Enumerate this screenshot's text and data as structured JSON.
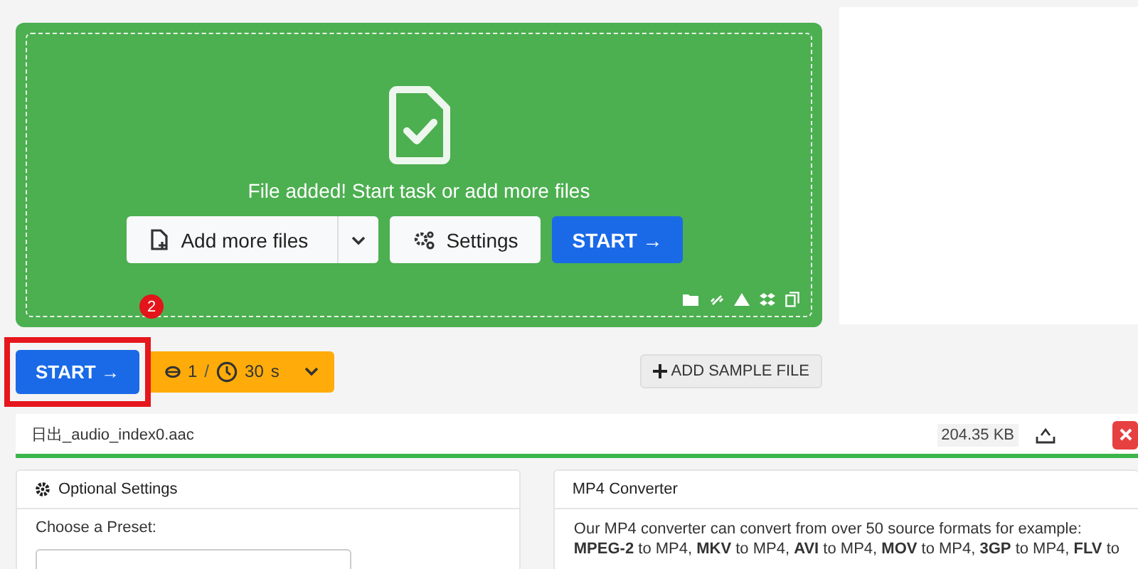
{
  "dropzone": {
    "message": "File added! Start task or add more files",
    "add_button": "Add more files",
    "settings_button": "Settings",
    "start_button": "START →"
  },
  "step_badge": "2",
  "toolbar": {
    "start_button": "START →",
    "credits": "1",
    "separator": "/",
    "time": "30",
    "unit": "s",
    "sample_button": "ADD SAMPLE FILE"
  },
  "file": {
    "name": "日出_audio_index0.aac",
    "size": "204.35 KB",
    "progress": {
      "level": 1
    }
  },
  "optional_settings": {
    "title": "Optional Settings",
    "preset_label": "Choose a Preset:"
  },
  "converter": {
    "title": "MP4 Converter",
    "text": "Our MP4 converter can convert from over 50 source formats for example:",
    "formats": "**MPEG-2** to MP4, **MKV** to MP4, **AVI** to MP4, **MOV** to MP4, **3GP** to MP4, **FLV** to"
  }
}
